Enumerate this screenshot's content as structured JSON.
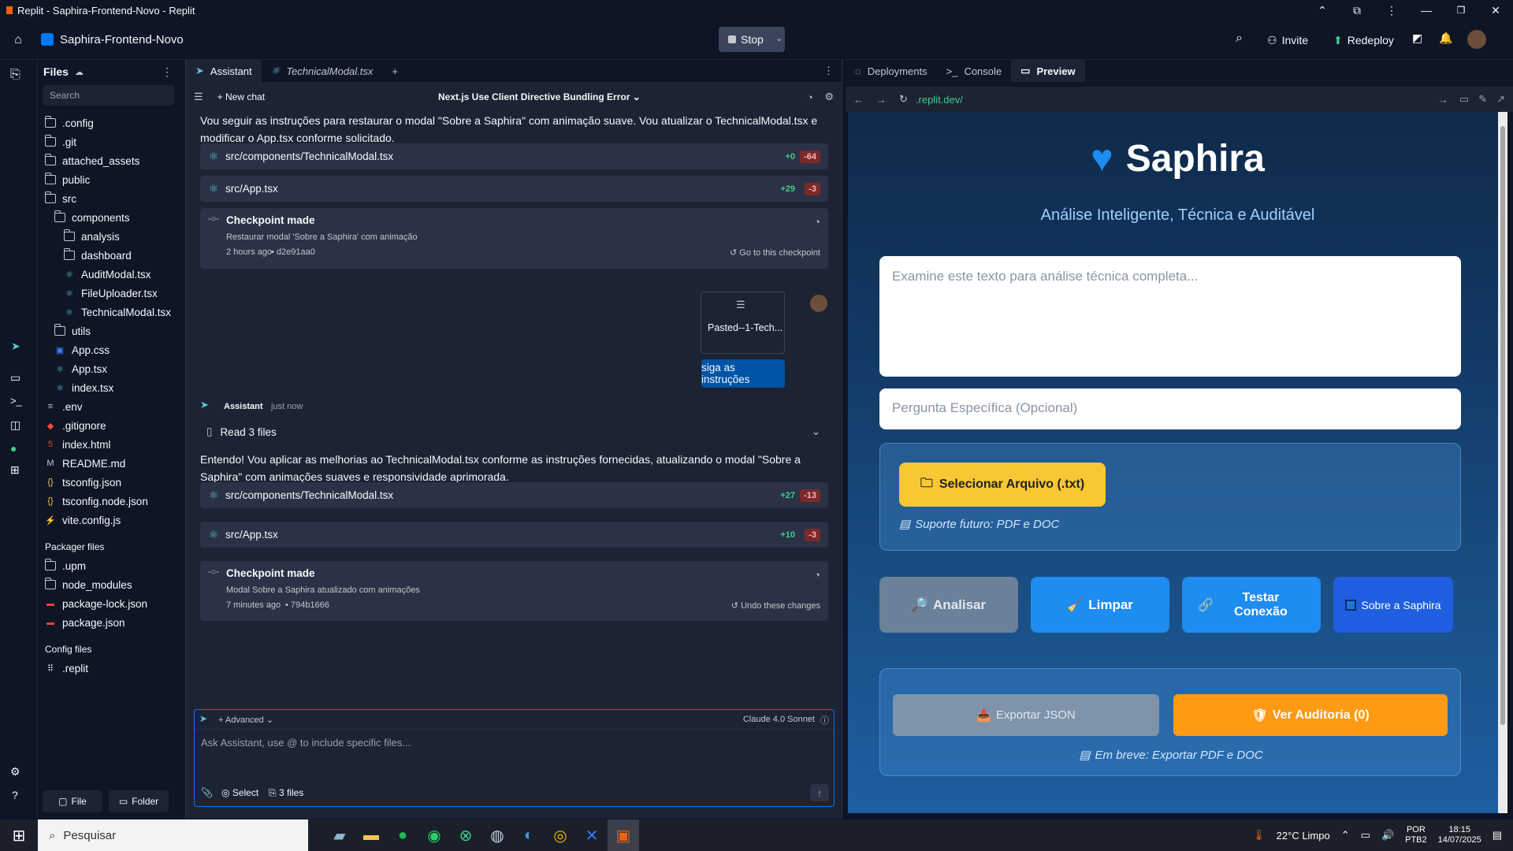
{
  "window": {
    "title": "Replit - Saphira-Frontend-Novo - Replit"
  },
  "appbar": {
    "project": "Saphira-Frontend-Novo",
    "stop": "Stop",
    "invite": "Invite",
    "redeploy": "Redeploy"
  },
  "files": {
    "title": "Files",
    "search_placeholder": "Search",
    "items": [
      ".config",
      ".git",
      "attached_assets",
      "public",
      "src",
      "components",
      "analysis",
      "dashboard",
      "AuditModal.tsx",
      "FileUploader.tsx",
      "TechnicalModal.tsx",
      "utils",
      "App.css",
      "App.tsx",
      "index.tsx",
      ".env",
      ".gitignore",
      "index.html",
      "README.md",
      "tsconfig.json",
      "tsconfig.node.json",
      "vite.config.js"
    ],
    "packager_title": "Packager files",
    "packager_items": [
      ".upm",
      "node_modules",
      "package-lock.json",
      "package.json"
    ],
    "config_title": "Config files",
    "config_items": [
      ".replit"
    ],
    "file_btn": "File",
    "folder_btn": "Folder"
  },
  "chat": {
    "tabs": [
      "Assistant",
      "TechnicalModal.tsx"
    ],
    "new_chat": "New chat",
    "thread_title": "Next.js Use Client Directive Bundling Error",
    "msg1": "Vou seguir as instruções para restaurar o modal \"Sobre a Saphira\" com animação suave. Vou atualizar o TechnicalModal.tsx e modificar o App.tsx conforme solicitado.",
    "card1": {
      "file": "src/components/TechnicalModal.tsx",
      "plus": "+0",
      "minus": "-64"
    },
    "card2": {
      "file": "src/App.tsx",
      "plus": "+29",
      "minus": "-3"
    },
    "cp1": {
      "title": "Checkpoint made",
      "desc": "Restaurar modal 'Sobre a Saphira' com animação",
      "time": "2 hours ago",
      "hash": "• d2e91aa0",
      "action": "Go to this checkpoint"
    },
    "attachment": "Pasted--1-Tech...",
    "user_msg": "siga as instruções",
    "assistant_name": "Assistant",
    "assistant_time": "just now",
    "read_files": "Read 3 files",
    "msg2": "Entendo! Vou aplicar as melhorias ao TechnicalModal.tsx conforme as instruções fornecidas, atualizando o modal \"Sobre a Saphira\" com animações suaves e responsividade aprimorada.",
    "card3": {
      "file": "src/components/TechnicalModal.tsx",
      "plus": "+27",
      "minus": "-13"
    },
    "card4": {
      "file": "src/App.tsx",
      "plus": "+10",
      "minus": "-3"
    },
    "cp2": {
      "title": "Checkpoint made",
      "desc": "Modal Sobre a Saphira atualizado com animações",
      "time": "7 minutes ago",
      "hash": "• 794b1666",
      "action": "Undo these changes"
    },
    "advanced": "Advanced",
    "model": "Claude 4.0 Sonnet",
    "input_placeholder": "Ask Assistant, use @ to include specific files...",
    "select": "Select",
    "files_count": "3 files"
  },
  "preview": {
    "tabs": [
      "Deployments",
      "Console",
      "Preview"
    ],
    "url": ".replit.dev/",
    "site": {
      "brand": "Saphira",
      "subtitle": "Análise Inteligente, Técnica e Auditável",
      "text_placeholder": "Examine este texto para análise técnica completa...",
      "question_placeholder": "Pergunta Específica (Opcional)",
      "select_file": "Selecionar Arquivo (.txt)",
      "future_support": "Suporte futuro: PDF e DOC",
      "analyze": "Analisar",
      "clear": "Limpar",
      "test": "Testar Conexão",
      "about": "Sobre a Saphira",
      "export_json": "Exportar JSON",
      "audit": "Ver Auditoria (0)",
      "soon": "Em breve: Exportar PDF e DOC"
    }
  },
  "taskbar": {
    "search": "Pesquisar",
    "weather": "22°C  Limpo",
    "lang1": "POR",
    "lang2": "PTB2",
    "time": "18:15",
    "date": "14/07/2025"
  },
  "colors": {
    "accent": "#0079f2",
    "yellow": "#f8c733",
    "orange": "#ff9a14",
    "blue_btn": "#1e8cf0"
  }
}
